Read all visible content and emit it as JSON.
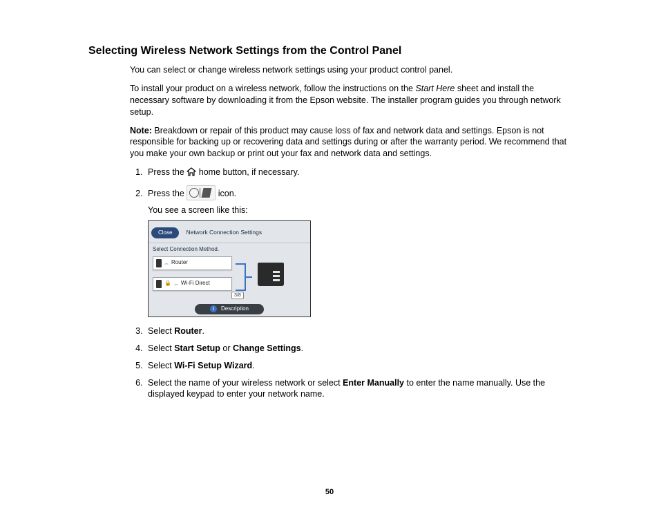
{
  "title": "Selecting Wireless Network Settings from the Control Panel",
  "intro": {
    "p1": "You can select or change wireless network settings using your product control panel.",
    "p2a": "To install your product on a wireless network, follow the instructions on the ",
    "p2_start_here": "Start Here",
    "p2b": " sheet and install the necessary software by downloading it from the Epson website. The installer program guides you through network setup."
  },
  "note": {
    "label": "Note:",
    "text": " Breakdown or repair of this product may cause loss of fax and network data and settings. Epson is not responsible for backing up or recovering data and settings during or after the warranty period. We recommend that you make your own backup or print out your fax and network data and settings."
  },
  "steps": {
    "s1a": "Press the ",
    "s1b": " home button, if necessary.",
    "s2a": "Press the ",
    "s2b": " icon.",
    "s2sub": "You see a screen like this:",
    "s3a": "Select ",
    "s3_router": "Router",
    "s3b": ".",
    "s4a": "Select ",
    "s4_start": "Start Setup",
    "s4_mid": " or ",
    "s4_change": "Change Settings",
    "s4b": ".",
    "s5a": "Select ",
    "s5_wiz": "Wi-Fi Setup Wizard",
    "s5b": ".",
    "s6a": "Select the name of your wireless network or select ",
    "s6_enter": "Enter Manually",
    "s6b": " to enter the name manually. Use the displayed keypad to enter your network name."
  },
  "screenshot": {
    "close": "Close",
    "header_title": "Network Connection Settings",
    "select_method": "Select Connection Method.",
    "router": "Router",
    "wifi_direct": "Wi-Fi Direct",
    "badge": "3/8",
    "description": "Description"
  },
  "page_number": "50"
}
